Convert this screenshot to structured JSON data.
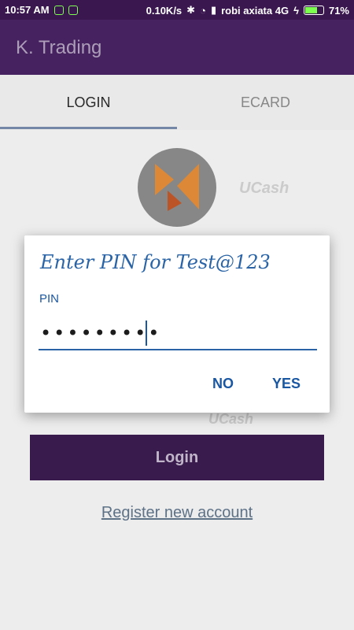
{
  "status_bar": {
    "time": "10:57 AM",
    "speed": "0.10K/s",
    "carrier": "robi axiata 4G",
    "battery": "71%",
    "battery_level": 0.71
  },
  "app_bar": {
    "title": "K. Trading"
  },
  "tabs": [
    {
      "label": "LOGIN",
      "selected": true
    },
    {
      "label": "ECARD",
      "selected": false
    }
  ],
  "background": {
    "brands": [
      "UCash",
      "UCash"
    ],
    "login_button": "Login",
    "register_link": "Register new account"
  },
  "dialog": {
    "title": "Enter PIN  for Test@123",
    "field_label": "PIN",
    "pin_value": "•••••••••",
    "no_label": "NO",
    "yes_label": "YES"
  },
  "colors": {
    "app_bar": "#4a2466",
    "accent": "#2a64a6",
    "login_button": "#3e1d52"
  }
}
